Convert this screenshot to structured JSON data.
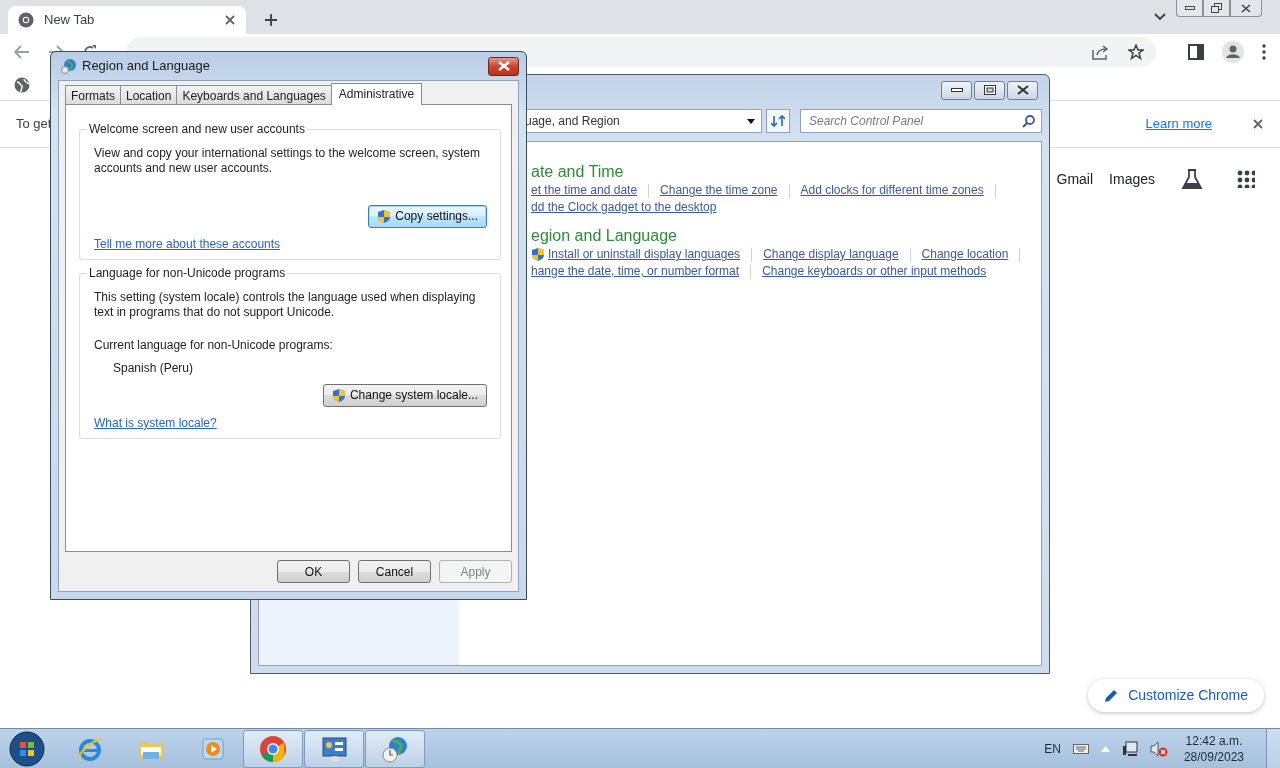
{
  "browser": {
    "tab": {
      "title": "New Tab"
    },
    "infobar": {
      "text": "To get",
      "link": "Learn more"
    },
    "shortcuts": [
      "Gmail",
      "Images"
    ],
    "customize_button": "Customize Chrome"
  },
  "control_panel": {
    "breadcrumb": "uage, and Region",
    "search": {
      "placeholder": "Search Control Panel"
    },
    "categories": [
      {
        "title": "ate and Time",
        "lines": [
          [
            {
              "label": "et the time and date",
              "shield": false
            },
            {
              "label": "Change the time zone",
              "shield": false
            },
            {
              "label": "Add clocks for different time zones",
              "shield": false
            }
          ],
          [
            {
              "label": "dd the Clock gadget to the desktop",
              "shield": false
            }
          ]
        ]
      },
      {
        "title": "egion and Language",
        "lines": [
          [
            {
              "label": "Install or uninstall display languages",
              "shield": true
            },
            {
              "label": "Change display language",
              "shield": false
            },
            {
              "label": "Change location",
              "shield": false
            }
          ],
          [
            {
              "label": "hange the date, time, or number format",
              "shield": false
            },
            {
              "label": "Change keyboards or other input methods",
              "shield": false
            }
          ]
        ]
      }
    ]
  },
  "dialog": {
    "title": "Region and Language",
    "tabs": [
      {
        "label": "Formats",
        "selected": false
      },
      {
        "label": "Location",
        "selected": false
      },
      {
        "label": "Keyboards and Languages",
        "selected": false
      },
      {
        "label": "Administrative",
        "selected": true
      }
    ],
    "groups": [
      {
        "title": "Welcome screen and new user accounts",
        "text": "View and copy your international settings to the welcome screen, system accounts and new user accounts.",
        "button": {
          "label": "Copy settings...",
          "focused": true
        },
        "link": "Tell me more about these accounts"
      },
      {
        "title": "Language for non-Unicode programs",
        "text": "This setting (system locale) controls the language used when displaying text in programs that do not support Unicode.",
        "label": "Current language for non-Unicode programs:",
        "value": "Spanish (Peru)",
        "button": {
          "label": "Change system locale...",
          "focused": false
        },
        "link": "What is system locale?"
      }
    ],
    "buttons": [
      {
        "label": "OK",
        "disabled": false
      },
      {
        "label": "Cancel",
        "disabled": false
      },
      {
        "label": "Apply",
        "disabled": true
      }
    ]
  },
  "taskbar": {
    "apps": [
      {
        "kind": "ie",
        "active": false
      },
      {
        "kind": "folder",
        "active": false
      },
      {
        "kind": "media",
        "active": false
      },
      {
        "kind": "chrome",
        "active": true
      },
      {
        "kind": "control-panel",
        "active": true
      },
      {
        "kind": "globe-clock",
        "active": true
      }
    ],
    "language": "EN",
    "time": "12:42 a.m.",
    "date": "28/09/2023"
  }
}
